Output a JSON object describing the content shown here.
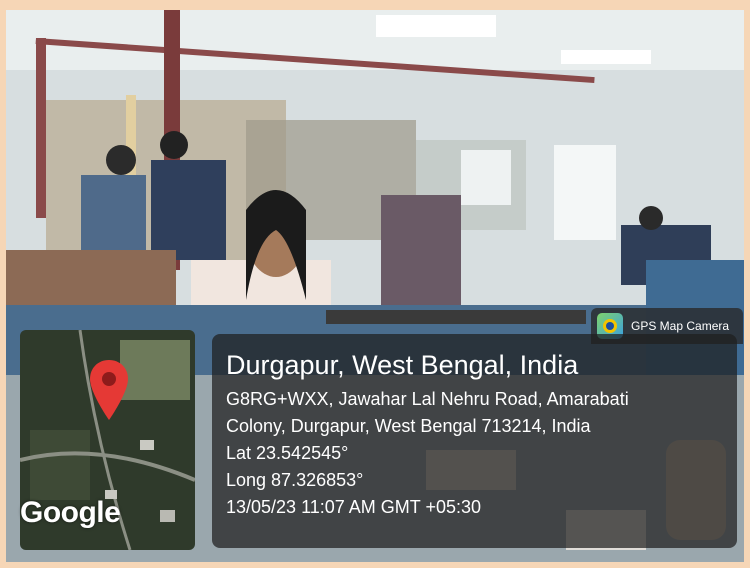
{
  "badge": {
    "label": "GPS Map Camera",
    "icon": "camera-icon"
  },
  "map": {
    "logo": "Google",
    "pin_color": "#e53935"
  },
  "location": {
    "title": "Durgapur, West Bengal, India",
    "address_line1": "G8RG+WXX, Jawahar Lal Nehru Road, Amarabati",
    "address_line2": "Colony, Durgapur, West Bengal 713214, India",
    "lat": "Lat 23.542545°",
    "long": "Long 87.326853°",
    "timestamp": "13/05/23 11:07 AM GMT +05:30"
  }
}
